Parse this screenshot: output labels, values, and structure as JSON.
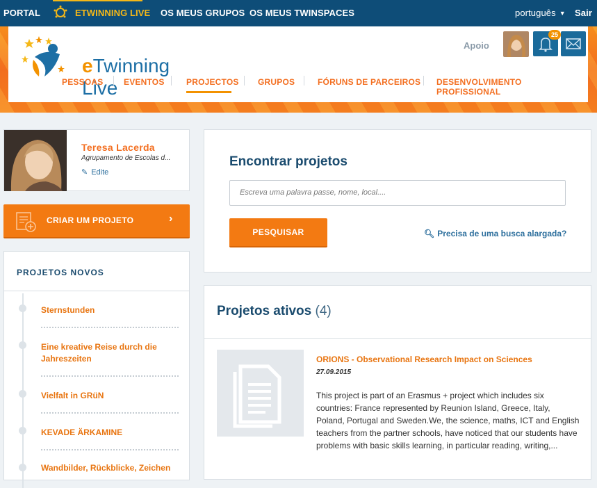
{
  "topbar": {
    "portal": "PORTAL",
    "etwinning_live": "ETWINNING LIVE",
    "os_meus_grupos": "OS MEUS GRUPOS",
    "os_meus_twinspaces": "OS MEUS TWINSPACES",
    "language": "português",
    "logout": "Sair"
  },
  "header": {
    "logo_e": "e",
    "logo_rest": "Twinning Live",
    "apoio": "Apoio",
    "notifications_count": "25",
    "nav": [
      "PESSOAS",
      "EVENTOS",
      "PROJECTOS",
      "GRUPOS",
      "FÓRUNS DE PARCEIROS",
      "DESENVOLVIMENTO PROFISSIONAL"
    ],
    "active_nav": "PROJECTOS"
  },
  "profile": {
    "name": "Teresa Lacerda",
    "school": "Agrupamento de Escolas d...",
    "edit": "Edite"
  },
  "create_project": {
    "label": "CRIAR UM PROJETO",
    "arrow": "›"
  },
  "new_projects": {
    "title": "PROJETOS NOVOS",
    "items": [
      "Sternstunden",
      "Eine kreative Reise durch die Jahreszeiten",
      "Vielfalt in GRüN",
      "KEVADE ÄRKAMINE",
      "Wandbilder, Rückblicke, Zeichen"
    ]
  },
  "search": {
    "title": "Encontrar projetos",
    "placeholder": "Escreva uma palavra passe, nome, local....",
    "button": "PESQUISAR",
    "advanced": "Precisa de uma busca alargada?"
  },
  "active_projects": {
    "title": "Projetos ativos",
    "count": "(4)",
    "projects": [
      {
        "name": "ORIONS - Observational Research Impact on Sciences",
        "date": "27.09.2015",
        "description": "This project is part of an Erasmus + project which includes six countries: France represented by Reunion Island, Greece, Italy, Poland, Portugal and Sweden.We, the science, maths, ICT and English teachers from the partner schools, have noticed that our students have problems with basic skills learning, in particular reading, writing,..."
      }
    ]
  },
  "colors": {
    "topbar": "#0e4d78",
    "accent_orange": "#f37a12",
    "live_yellow": "#f5b818",
    "heading_blue": "#1a4b6e",
    "link_blue": "#2d6f9d"
  }
}
